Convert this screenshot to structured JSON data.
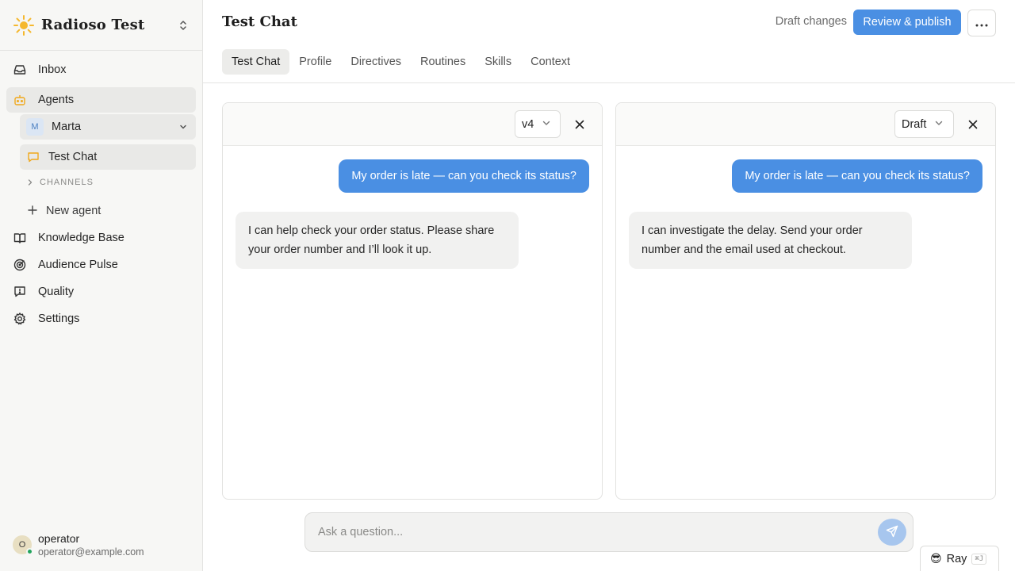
{
  "workspace": {
    "name": "Radioso Test"
  },
  "sidebar": {
    "inbox": "Inbox",
    "agents": "Agents",
    "agent": {
      "initial": "M",
      "name": "Marta"
    },
    "test_chat": "Test Chat",
    "channels": "CHANNELS",
    "new_agent": "New agent",
    "knowledge_base": "Knowledge Base",
    "audience_pulse": "Audience Pulse",
    "quality": "Quality",
    "settings": "Settings"
  },
  "user": {
    "initial": "O",
    "name": "operator",
    "email": "operator@example.com"
  },
  "header": {
    "title": "Test Chat",
    "draft_label": "Draft changes",
    "publish_label": "Review & publish"
  },
  "tabs": [
    "Test Chat",
    "Profile",
    "Directives",
    "Routines",
    "Skills",
    "Context"
  ],
  "panels": [
    {
      "version": "v4",
      "user_message": "My order is late — can you check its status?",
      "bot_message": "I can help check your order status. Please share your order number and I’ll look it up."
    },
    {
      "version": "Draft",
      "user_message": "My order is late — can you check its status?",
      "bot_message": "I can investigate the delay. Send your order number and the email used at checkout."
    }
  ],
  "composer": {
    "placeholder": "Ask a question..."
  },
  "assistant": {
    "emoji": "😎",
    "label": "Ray",
    "shortcut": "⌘J"
  },
  "colors": {
    "accent": "#4a8fe3",
    "online": "#22a45d",
    "logo": "#f5b82e"
  }
}
